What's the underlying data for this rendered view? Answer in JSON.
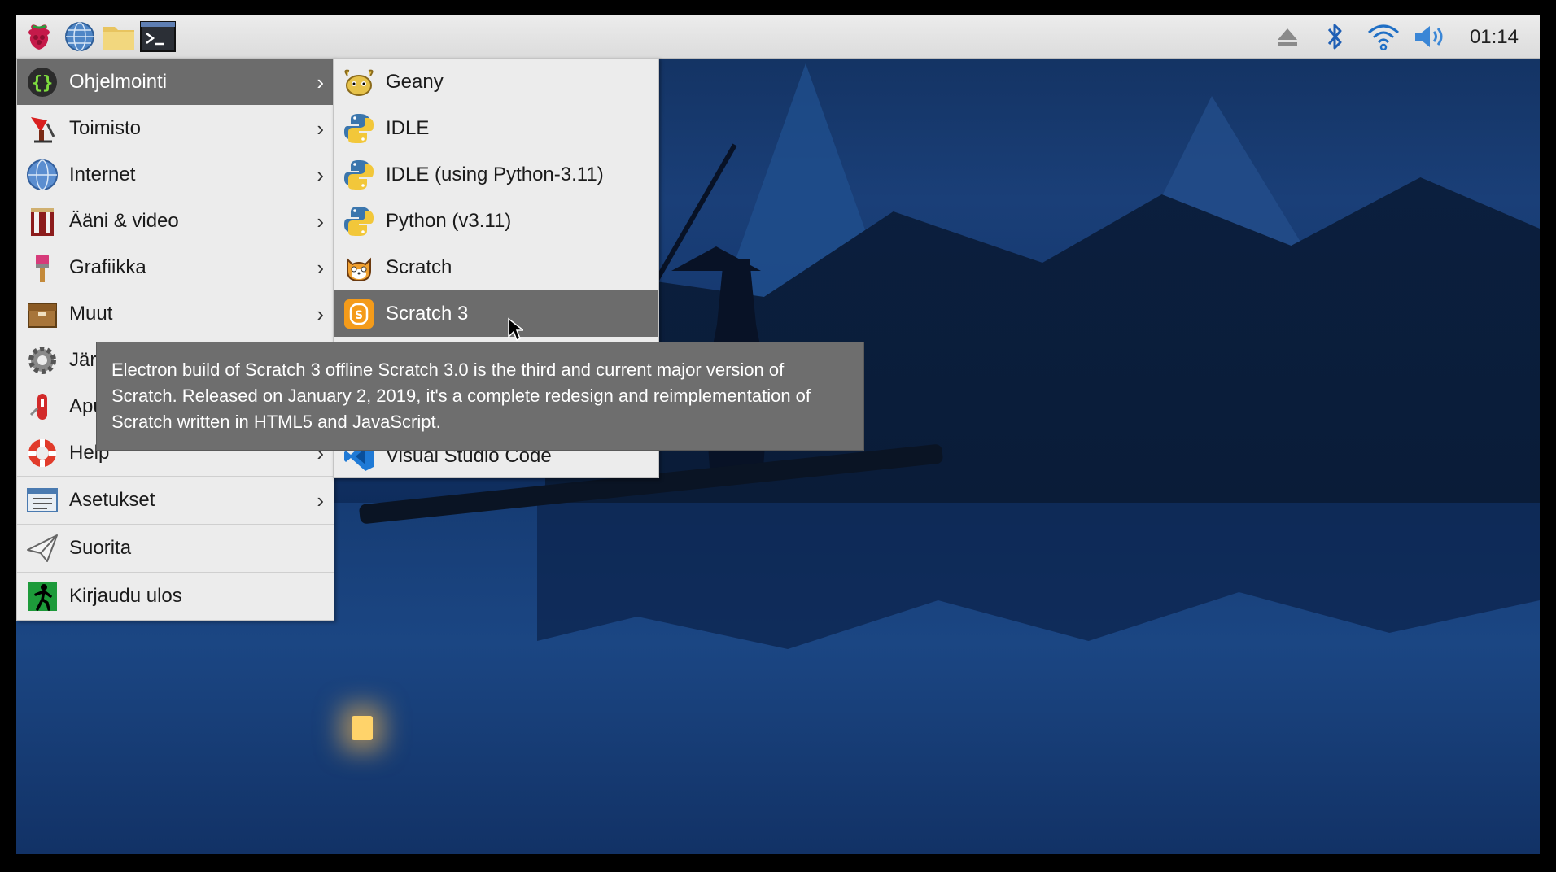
{
  "taskbar": {
    "launchers": [
      "raspberry-menu",
      "web-browser",
      "file-manager",
      "terminal"
    ],
    "tray_icons": [
      "eject-icon",
      "bluetooth-icon",
      "wifi-icon",
      "volume-icon"
    ],
    "clock": "01:14"
  },
  "main_menu": {
    "items": [
      {
        "label": "Ohjelmointi",
        "icon": "braces-icon",
        "submenu": true,
        "selected": true
      },
      {
        "label": "Toimisto",
        "icon": "office-icon",
        "submenu": true
      },
      {
        "label": "Internet",
        "icon": "globe-icon",
        "submenu": true
      },
      {
        "label": "Ääni & video",
        "icon": "media-icon",
        "submenu": true
      },
      {
        "label": "Grafiikka",
        "icon": "paintbrush-icon",
        "submenu": true
      },
      {
        "label": "Muut",
        "icon": "box-icon",
        "submenu": true
      },
      {
        "label": "Jär",
        "icon": "gear-icon",
        "submenu": true
      },
      {
        "label": "Apu",
        "icon": "toolkit-icon",
        "submenu": true
      },
      {
        "label": "Help",
        "icon": "lifebuoy-icon",
        "submenu": true
      },
      {
        "label": "Asetukset",
        "icon": "settings-icon",
        "submenu": true
      },
      {
        "label": "Suorita",
        "icon": "paper-plane-icon",
        "submenu": false
      },
      {
        "label": "Kirjaudu ulos",
        "icon": "exit-icon",
        "submenu": false
      }
    ]
  },
  "sub_menu": {
    "items": [
      {
        "label": "Geany",
        "icon": "geany-icon"
      },
      {
        "label": "IDLE",
        "icon": "python-icon"
      },
      {
        "label": "IDLE (using Python-3.11)",
        "icon": "python-icon"
      },
      {
        "label": "Python (v3.11)",
        "icon": "python-icon"
      },
      {
        "label": "Scratch",
        "icon": "scratch-cat-icon"
      },
      {
        "label": "Scratch 3",
        "icon": "scratch3-icon",
        "selected": true
      },
      {
        "label": "Visual Studio Code",
        "icon": "vscode-icon"
      }
    ]
  },
  "tooltip": {
    "line1": "Electron build of Scratch 3 offline Scratch 3.0 is the third and current major version of",
    "line2": "Scratch. Released on January 2, 2019, it's a complete redesign and reimplementation of",
    "line3": "Scratch written in HTML5 and JavaScript."
  },
  "colors": {
    "menu_bg": "#ececec",
    "selection": "#6c6c6c",
    "tooltip_bg": "#6e6e6e",
    "wallpaper": "#1a3f78"
  }
}
